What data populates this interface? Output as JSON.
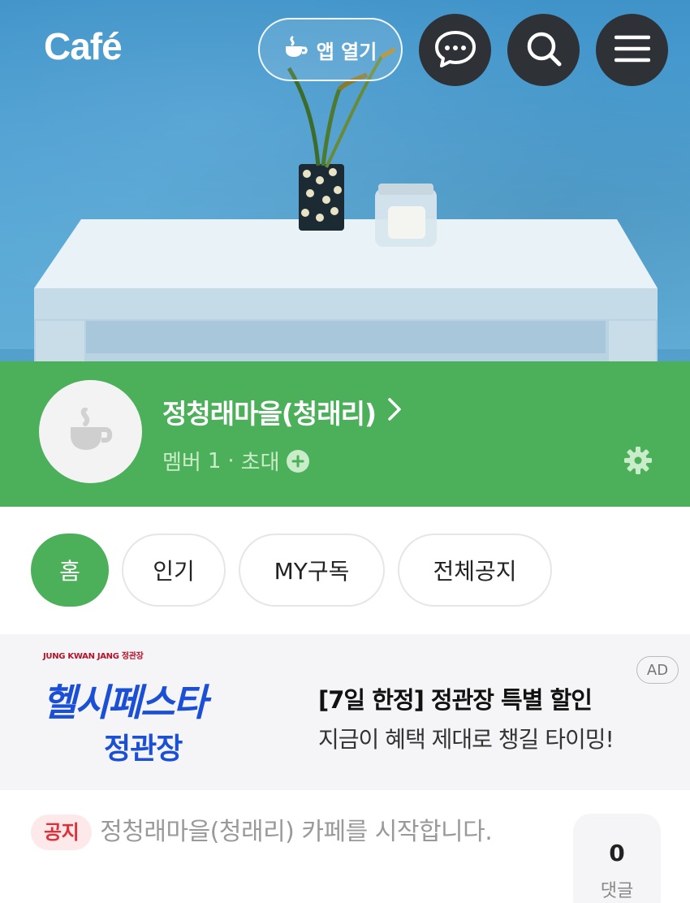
{
  "header": {
    "logo": "Café",
    "open_app_label": "앱 열기",
    "icons": [
      "coffee-cup-icon",
      "chat-bubble-icon",
      "search-icon",
      "menu-icon"
    ]
  },
  "cafe": {
    "name": "정청래마을(청래리)",
    "member_label": "멤버",
    "member_count": "1",
    "invite_label": "초대"
  },
  "tabs": [
    {
      "label": "홈",
      "active": true
    },
    {
      "label": "인기",
      "active": false
    },
    {
      "label": "MY구독",
      "active": false
    },
    {
      "label": "전체공지",
      "active": false
    }
  ],
  "ad": {
    "brand": "JUNG KWAN JANG 정관장",
    "logo_line1": "헬시페스타",
    "logo_line2": "정관장",
    "title": "[7일 한정] 정관장 특별 할인",
    "subtitle": "지금이 혜택 제대로 챙길 타이밍!",
    "badge": "AD"
  },
  "post": {
    "tag": "공지",
    "title": "정청래마을(청래리) 카페를 시작합니다.",
    "comment_count": "0",
    "comment_label": "댓글"
  },
  "colors": {
    "brand_green": "#4caf5a",
    "notice_red": "#e0313b",
    "ad_blue": "#1a4fd6",
    "dark_button": "#2e3136"
  }
}
